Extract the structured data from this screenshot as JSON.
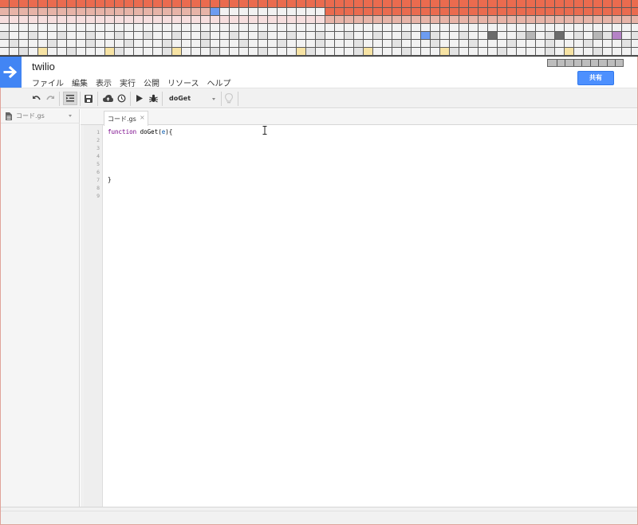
{
  "app": {
    "title": "twilio",
    "share_label": "共有",
    "menu": [
      "ファイル",
      "編集",
      "表示",
      "実行",
      "公開",
      "リソース",
      "ヘルプ"
    ]
  },
  "toolbar": {
    "function_select": "doGet"
  },
  "sidebar": {
    "files": [
      {
        "name": "コード.gs"
      }
    ]
  },
  "tabs": [
    {
      "label": "コード.gs",
      "close": "×"
    }
  ],
  "editor": {
    "line_numbers": [
      "1",
      "2",
      "3",
      "4",
      "5",
      "6",
      "7",
      "8",
      "9"
    ],
    "lines": [
      "function doGet(e){",
      "",
      "",
      "",
      "",
      "",
      "}",
      "",
      ""
    ],
    "code_tokens": {
      "keyword": "function",
      "name": " doGet(",
      "param": "e",
      "rest": "){",
      "close_brace": "}"
    }
  },
  "colors": {
    "accent_blue": "#4285f4",
    "share_blue": "#4d90fe",
    "banner_orange": "#ea6b4f",
    "banner_pink": "#e7b4a8",
    "keyword_purple": "#770088",
    "param_blue": "#0055aa"
  },
  "icons": {
    "logo": "arrow-right-icon",
    "undo": "undo-icon",
    "redo": "redo-icon",
    "indent": "indent-icon",
    "save": "save-icon",
    "cloud": "cloud-upload-icon",
    "clock": "clock-icon",
    "run": "play-icon",
    "debug": "bug-icon",
    "hint": "lightbulb-icon",
    "file": "file-icon"
  }
}
